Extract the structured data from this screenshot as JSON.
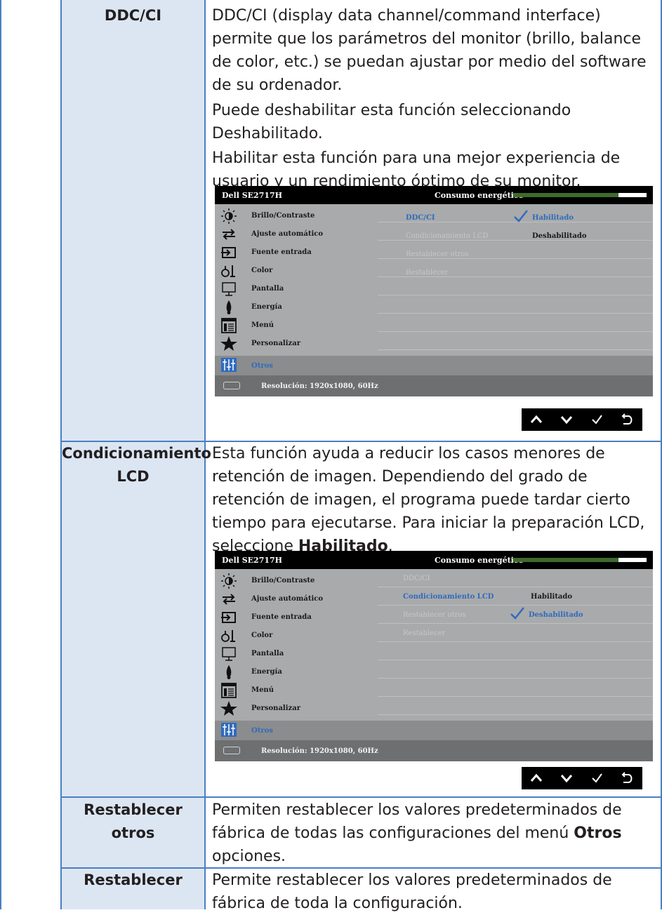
{
  "rows": [
    {
      "label": "DDC/CI",
      "paragraphs": [
        "DDC/CI (display data channel/command interface) permite que los parámetros del monitor (brillo, balance de color, etc.) se puedan ajustar por medio del software de su ordenador.",
        "Puede deshabilitar esta función seleccionando Deshabilitado.",
        "Habilitar esta función para una mejor experiencia de usuario y un rendimiento óptimo de su monitor."
      ]
    },
    {
      "label_line1": "Condicionamiento",
      "label_line2": "LCD",
      "text_before": "Esta función ayuda a reducir los casos menores de retención de imagen. Dependiendo del grado de retención de imagen, el programa puede tardar cierto tiempo para ejecutarse. Para iniciar la preparación LCD, seleccione ",
      "text_bold": "Habilitado",
      "text_after": "."
    },
    {
      "label_line1": "Restablecer",
      "label_line2": "otros",
      "text_before": "Permiten restablecer los valores predeterminados de fábrica de todas las configuraciones del menú ",
      "text_bold": "Otros",
      "text_after": " opciones."
    },
    {
      "label": "Restablecer",
      "text": "Permite restablecer los valores predeterminados de fábrica de toda la configuración."
    }
  ],
  "osd": {
    "model": "Dell SE2717H",
    "energy_label": "Consumo energético",
    "menu_items": [
      "Brillo/Contraste",
      "Ajuste automático",
      "Fuente entrada",
      "Color",
      "Pantalla",
      "Energía",
      "Menú",
      "Personalizar",
      "Otros"
    ],
    "menu_icons": [
      "brightness-icon",
      "auto-adjust-icon",
      "input-source-icon",
      "color-icon",
      "display-icon",
      "energy-icon",
      "menu-icon",
      "personalize-icon",
      "others-icon"
    ],
    "submenu": [
      "DDC/CI",
      "Condicionamiento LCD",
      "Restablecer otros",
      "Restablecer"
    ],
    "option_enabled": "Habilitado",
    "option_disabled": "Deshabilitado",
    "footer": "Resolución: 1920x1080, 60Hz",
    "colors": {
      "selected_text": "#2f6bbd",
      "panel": "#a9aaab",
      "footer": "#6e6f70",
      "energy_bar": "#3e6b2b"
    }
  },
  "nav_buttons": [
    "up-icon",
    "down-icon",
    "check-icon",
    "back-icon"
  ]
}
